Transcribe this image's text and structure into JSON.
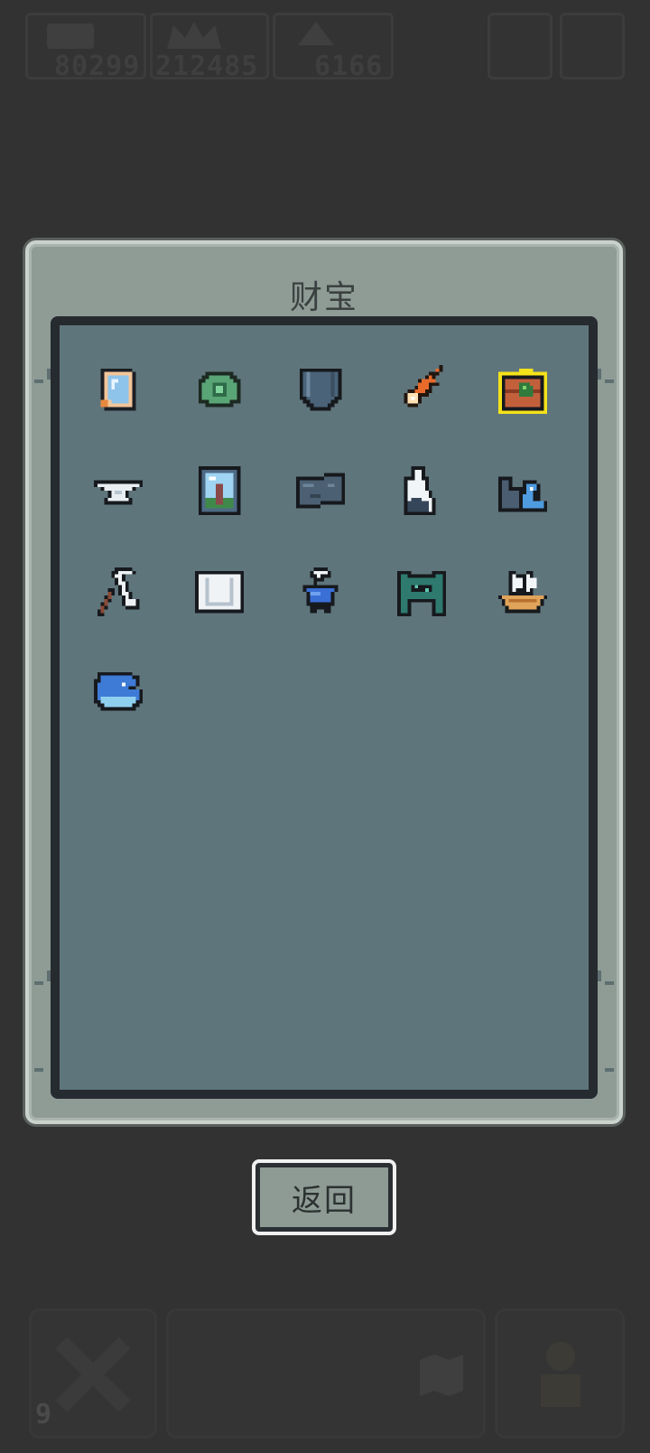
{
  "hud": {
    "resource_1": "80299",
    "resource_2": "212485",
    "resource_3": "6166",
    "badge_count": "9"
  },
  "dialog": {
    "title": "财宝",
    "back_label": "返回"
  },
  "treasures": [
    {
      "icon": "mirror-icon"
    },
    {
      "icon": "turtle-shell-icon"
    },
    {
      "icon": "shield-icon"
    },
    {
      "icon": "comet-icon"
    },
    {
      "icon": "treasure-chest-icon",
      "selected": true
    },
    {
      "icon": "anvil-icon"
    },
    {
      "icon": "painting-icon"
    },
    {
      "icon": "stone-block-icon"
    },
    {
      "icon": "snowy-rock-icon"
    },
    {
      "icon": "wave-wall-icon"
    },
    {
      "icon": "scythe-icon"
    },
    {
      "icon": "scroll-icon"
    },
    {
      "icon": "cauldron-icon"
    },
    {
      "icon": "gate-icon"
    },
    {
      "icon": "ship-icon"
    },
    {
      "icon": "whale-icon"
    }
  ],
  "colors": {
    "background": "#323232",
    "panel": "#8f9c96",
    "inner_panel": "#5f757c",
    "selected_border": "#f4e21a"
  }
}
